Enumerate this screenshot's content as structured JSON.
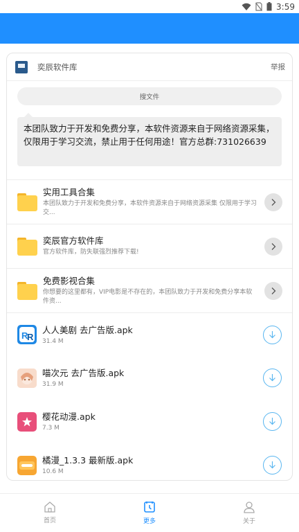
{
  "status_bar": {
    "time": "3:59"
  },
  "card": {
    "brand_name": "奕辰软件库",
    "report_label": "举报",
    "search_placeholder": "搜文件",
    "notice_text": "本团队致力于开发和免费分享，本软件资源来自于网络资源采集，仅限用于学习交流，禁止用于任何用途！官方总群:731026639"
  },
  "folders": [
    {
      "title": "实用工具合集",
      "desc": "本团队致力于开发和免费分享，本软件资源来自于网络资源采集 仅限用于学习交..."
    },
    {
      "title": "奕辰官方软件库",
      "desc": "官方软件库，防失联强烈推荐下载!"
    },
    {
      "title": "免费影视合集",
      "desc": "你想要的这里都有，VIP电影是不存在的，本团队致力于开发和免费分享本软件资..."
    }
  ],
  "files": [
    {
      "title": "人人美剧 去广告版.apk",
      "size": "31.4 M",
      "icon": "rr-app-icon",
      "color": "#1e88e5"
    },
    {
      "title": "喵次元 去广告版.apk",
      "size": "31.9 M",
      "icon": "anime-girl-app-icon",
      "color": "#f3b89a"
    },
    {
      "title": "樱花动漫.apk",
      "size": "7.3 M",
      "icon": "sakura-app-icon",
      "color": "#e84f7a"
    },
    {
      "title": "橘漫_1.3.3 最新版.apk",
      "size": "10.6 M",
      "icon": "juman-app-icon",
      "color": "#f7a632"
    }
  ],
  "bottom_nav": [
    {
      "label": "首页",
      "icon": "home-icon",
      "active": false
    },
    {
      "label": "更多",
      "icon": "more-icon",
      "active": true
    },
    {
      "label": "关于",
      "icon": "person-icon",
      "active": false
    }
  ],
  "colors": {
    "header": "#1f8fff",
    "accent": "#1f8fff",
    "download": "#59b6f0",
    "folder": "#ffd14d"
  }
}
